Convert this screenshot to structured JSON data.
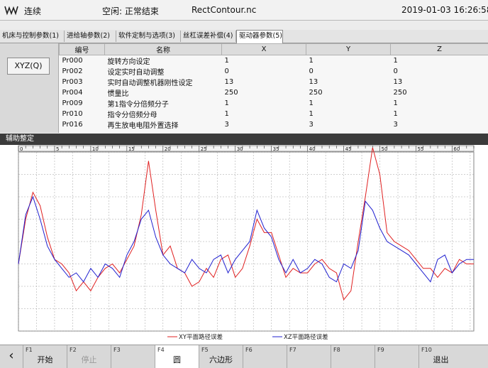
{
  "header": {
    "mode": "连续",
    "status": "空闲: 正常结束",
    "program": "RectContour.nc",
    "datetime": "2019-01-03  16:26:58"
  },
  "tabs": [
    {
      "label": "机床与控制参数(1)",
      "active": false
    },
    {
      "label": "进给轴参数(2)",
      "active": false
    },
    {
      "label": "软件定制与选项(3)",
      "active": false
    },
    {
      "label": "丝杠误差补偿(4)",
      "active": false
    },
    {
      "label": "驱动器参数(5)",
      "active": true
    }
  ],
  "axis_button": "XYZ(Q)",
  "param_table": {
    "headers": [
      "编号",
      "名称",
      "X",
      "Y",
      "Z"
    ],
    "rows": [
      [
        "Pr000",
        "旋转方向设定",
        "1",
        "1",
        "1"
      ],
      [
        "Pr002",
        "设定实时自动调整",
        "0",
        "0",
        "0"
      ],
      [
        "Pr003",
        "实时自动调整机器刚性设定",
        "13",
        "13",
        "13"
      ],
      [
        "Pr004",
        "惯量比",
        "250",
        "250",
        "250"
      ],
      [
        "Pr009",
        "第1指令分倍频分子",
        "1",
        "1",
        "1"
      ],
      [
        "Pr010",
        "指令分倍频分母",
        "1",
        "1",
        "1"
      ],
      [
        "Pr016",
        "再生放电电阻外置选择",
        "3",
        "3",
        "3"
      ]
    ]
  },
  "section_title": "辅助整定",
  "chart_data": {
    "type": "line",
    "x_ticks": [
      "0",
      "5",
      "10",
      "15",
      "20",
      "25",
      "30",
      "35",
      "40",
      "45",
      "50",
      "55",
      "60"
    ],
    "xlim": [
      0,
      63
    ],
    "ylim": [
      -1,
      1
    ],
    "grid": true,
    "legend_position": "bottom-center",
    "series": [
      {
        "name": "XY平面路径误差",
        "color": "#e02020",
        "x": [
          0,
          1,
          2,
          3,
          4,
          5,
          6,
          7,
          8,
          9,
          10,
          11,
          12,
          13,
          14,
          15,
          16,
          17,
          18,
          19,
          20,
          21,
          22,
          23,
          24,
          25,
          26,
          27,
          28,
          29,
          30,
          31,
          32,
          33,
          34,
          35,
          36,
          37,
          38,
          39,
          40,
          41,
          42,
          43,
          44,
          45,
          46,
          47,
          48,
          49,
          50,
          51,
          52,
          53,
          54,
          55,
          56,
          57,
          58,
          59,
          60,
          61,
          62,
          63
        ],
        "y": [
          -0.25,
          0.25,
          0.55,
          0.4,
          0.05,
          -0.2,
          -0.25,
          -0.35,
          -0.55,
          -0.45,
          -0.55,
          -0.4,
          -0.3,
          -0.25,
          -0.35,
          -0.2,
          -0.05,
          0.3,
          0.9,
          0.35,
          -0.15,
          -0.05,
          -0.3,
          -0.35,
          -0.5,
          -0.45,
          -0.3,
          -0.4,
          -0.2,
          -0.15,
          -0.4,
          -0.3,
          -0.05,
          0.25,
          0.1,
          0.1,
          -0.15,
          -0.4,
          -0.3,
          -0.35,
          -0.35,
          -0.25,
          -0.2,
          -0.3,
          -0.35,
          -0.65,
          -0.55,
          0.0,
          0.5,
          1.05,
          0.75,
          0.1,
          0.0,
          -0.05,
          -0.1,
          -0.2,
          -0.3,
          -0.3,
          -0.4,
          -0.3,
          -0.35,
          -0.2,
          -0.25,
          -0.25
        ]
      },
      {
        "name": "XZ平面路径误差",
        "color": "#2020d0",
        "x": [
          0,
          1,
          2,
          3,
          4,
          5,
          6,
          7,
          8,
          9,
          10,
          11,
          12,
          13,
          14,
          15,
          16,
          17,
          18,
          19,
          20,
          21,
          22,
          23,
          24,
          25,
          26,
          27,
          28,
          29,
          30,
          31,
          32,
          33,
          34,
          35,
          36,
          37,
          38,
          39,
          40,
          41,
          42,
          43,
          44,
          45,
          46,
          47,
          48,
          49,
          50,
          51,
          52,
          53,
          54,
          55,
          56,
          57,
          58,
          59,
          60,
          61,
          62,
          63
        ],
        "y": [
          -0.25,
          0.3,
          0.5,
          0.25,
          -0.05,
          -0.2,
          -0.3,
          -0.4,
          -0.35,
          -0.45,
          -0.3,
          -0.4,
          -0.25,
          -0.3,
          -0.4,
          -0.15,
          0.0,
          0.25,
          0.35,
          0.05,
          -0.15,
          -0.25,
          -0.3,
          -0.35,
          -0.2,
          -0.3,
          -0.35,
          -0.2,
          -0.15,
          -0.35,
          -0.2,
          -0.1,
          0.0,
          0.35,
          0.15,
          0.05,
          -0.2,
          -0.35,
          -0.2,
          -0.35,
          -0.3,
          -0.2,
          -0.25,
          -0.4,
          -0.45,
          -0.25,
          -0.3,
          -0.1,
          0.45,
          0.35,
          0.15,
          0.0,
          -0.05,
          -0.1,
          -0.15,
          -0.25,
          -0.35,
          -0.45,
          -0.2,
          -0.15,
          -0.35,
          -0.25,
          -0.2,
          -0.2
        ]
      }
    ]
  },
  "fkeys": [
    {
      "fn": "F1",
      "label": "开始",
      "active": false,
      "disabled": false
    },
    {
      "fn": "F2",
      "label": "停止",
      "active": false,
      "disabled": true
    },
    {
      "fn": "F3",
      "label": "",
      "active": false,
      "disabled": false
    },
    {
      "fn": "F4",
      "label": "圆",
      "active": true,
      "disabled": false
    },
    {
      "fn": "F5",
      "label": "六边形",
      "active": false,
      "disabled": false
    },
    {
      "fn": "F6",
      "label": "",
      "active": false,
      "disabled": false
    },
    {
      "fn": "F7",
      "label": "",
      "active": false,
      "disabled": false
    },
    {
      "fn": "F8",
      "label": "",
      "active": false,
      "disabled": false
    },
    {
      "fn": "F9",
      "label": "",
      "active": false,
      "disabled": false
    },
    {
      "fn": "F10",
      "label": "退出",
      "active": false,
      "disabled": false
    }
  ],
  "back_glyph": "‹",
  "icons": {
    "logo": "waveform-logo-icon",
    "back": "back-arrow-icon"
  }
}
